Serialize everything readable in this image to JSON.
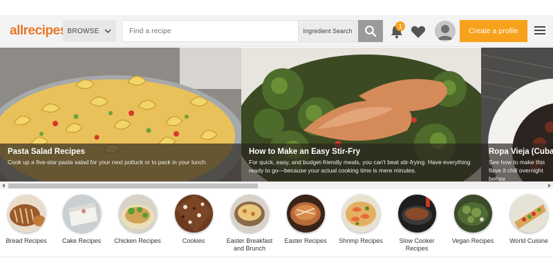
{
  "header": {
    "logo": "allrecipes",
    "browse_label": "BROWSE",
    "search_placeholder": "Find a recipe",
    "ingredient_label": "Ingredient Search",
    "notification_count": "1",
    "create_profile_label": "Create a profile",
    "accent_color": "#f7a21b"
  },
  "carousel": {
    "slides": [
      {
        "title": "Pasta Salad Recipes",
        "description": "Cook up a five-star pasta salad for your next potluck or to pack in your lunch."
      },
      {
        "title": "How to Make an Easy Stir-Fry",
        "description": "For quick, easy, and budget-friendly meals, you can't beat stir-frying. Have everything ready to go—because your actual cooking time is mere minutes."
      },
      {
        "title": "Ropa Vieja (Cuban B",
        "description": "See how to make this flave it chill overnight before"
      }
    ]
  },
  "categories": [
    {
      "label": "Bread Recipes"
    },
    {
      "label": "Cake Recipes"
    },
    {
      "label": "Chicken Recipes"
    },
    {
      "label": "Cookies"
    },
    {
      "label": "Easter Breakfast and Brunch"
    },
    {
      "label": "Easter Recipes"
    },
    {
      "label": "Shrimp Recipes"
    },
    {
      "label": "Slow Cooker Recipes"
    },
    {
      "label": "Vegan Recipes"
    },
    {
      "label": "World Cuisine"
    }
  ]
}
